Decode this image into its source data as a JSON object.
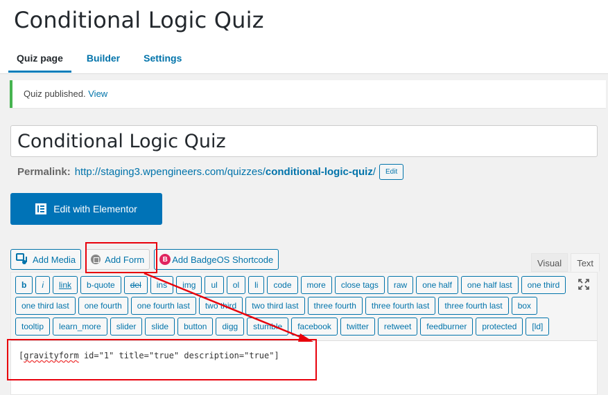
{
  "page_title": "Conditional Logic Quiz",
  "tabs": [
    "Quiz page",
    "Builder",
    "Settings"
  ],
  "notice": {
    "text": "Quiz published.",
    "link": "View"
  },
  "post_title": "Conditional Logic Quiz",
  "permalink": {
    "label": "Permalink:",
    "base": "http://staging3.wpengineers.com/quizzes/",
    "slug": "conditional-logic-quiz",
    "trail": "/",
    "edit": "Edit"
  },
  "elementor_button": "Edit with Elementor",
  "media_buttons": {
    "add_media": "Add Media",
    "add_form": "Add Form",
    "badgeos": "Add BadgeOS Shortcode"
  },
  "editor_tabs": {
    "visual": "Visual",
    "text": "Text"
  },
  "quicktags": {
    "row1": [
      "b",
      "i",
      "link",
      "b-quote",
      "del",
      "ins",
      "img",
      "ul",
      "ol",
      "li",
      "code",
      "more",
      "close tags",
      "raw",
      "one half",
      "one half last",
      "one third"
    ],
    "row2": [
      "one third last",
      "one fourth",
      "one fourth last",
      "two third",
      "two third last",
      "three fourth",
      "three fourth last",
      "three fourth last",
      "box"
    ],
    "row3": [
      "tooltip",
      "learn_more",
      "slider",
      "slide",
      "button",
      "digg",
      "stumble",
      "facebook",
      "twitter",
      "retweet",
      "feedburner",
      "protected",
      "[ld]"
    ]
  },
  "editor_content": {
    "open": "[",
    "word": "gravityform",
    "rest": " id=\"1\" title=\"true\" description=\"true\"]"
  },
  "colors": {
    "accent": "#0073aa",
    "elementor": "#0073b7",
    "highlight": "#e8000b",
    "notice_border": "#46b450"
  }
}
